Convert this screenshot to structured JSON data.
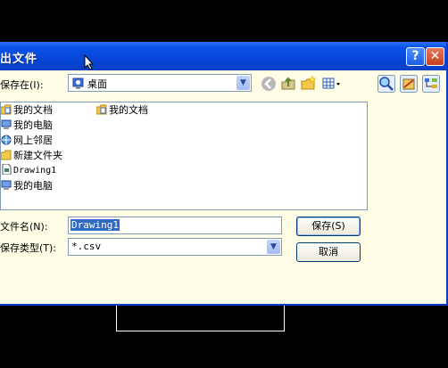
{
  "window": {
    "title": "出文件",
    "help_label": "?",
    "close_label": "✕"
  },
  "savein": {
    "label": "保存在(I):",
    "value": "桌面"
  },
  "toolbar": {
    "back_icon": "back-arrow-icon",
    "up_icon": "up-folder-icon",
    "new_folder_icon": "new-folder-icon",
    "views_icon": "views-menu-icon"
  },
  "files": [
    {
      "label": "我的文档",
      "icon": "documents-folder-icon"
    },
    {
      "label": "我的电脑",
      "icon": "computer-icon"
    },
    {
      "label": "网上邻居",
      "icon": "network-icon"
    },
    {
      "label": "新建文件夹",
      "icon": "folder-icon"
    },
    {
      "label": "Drawing1",
      "icon": "file-icon"
    },
    {
      "label": "我的电脑",
      "icon": "computer-icon"
    },
    {
      "label": "我的文档",
      "icon": "documents-folder-icon"
    }
  ],
  "filename": {
    "label": "文件名(N):",
    "value": "Drawing1"
  },
  "filetype": {
    "label": "保存类型(T):",
    "value": "*.csv"
  },
  "buttons": {
    "save": "保存(S)",
    "cancel": "取消"
  }
}
